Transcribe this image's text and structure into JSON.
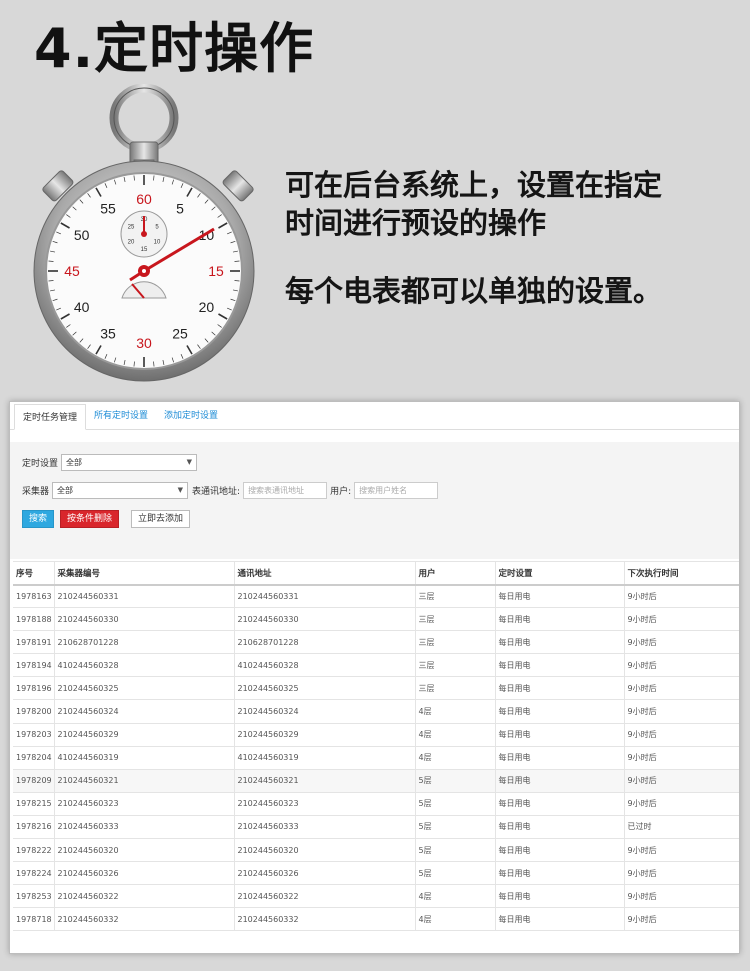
{
  "hero": {
    "title": "4.定时操作",
    "desc_line1": "可在后台系统上，设置在指定",
    "desc_line2": "时间进行预设的操作",
    "desc3": "每个电表都可以单独的设置。"
  },
  "stopwatch": {
    "numbers": [
      "60",
      "5",
      "10",
      "15",
      "20",
      "25",
      "30",
      "35",
      "40",
      "45",
      "50",
      "55"
    ],
    "sub_numbers": [
      "30",
      "5",
      "10",
      "15",
      "20",
      "25"
    ],
    "accent": "#c8161d"
  },
  "tabs": [
    {
      "label": "定时任务管理",
      "active": true
    },
    {
      "label": "所有定时设置",
      "active": false
    },
    {
      "label": "添加定时设置",
      "active": false
    }
  ],
  "filters": {
    "timer_label": "定时设置",
    "timer_value": "全部",
    "collector_label": "采集器",
    "collector_value": "全部",
    "address_label": "表通讯地址:",
    "address_placeholder": "搜索表通讯地址",
    "user_label": "用户:",
    "user_placeholder": "搜索用户姓名"
  },
  "buttons": {
    "search": "搜索",
    "delete": "按条件删除",
    "add": "立即去添加"
  },
  "table": {
    "headers": [
      "序号",
      "采集器编号",
      "通讯地址",
      "用户",
      "定时设置",
      "下次执行时间"
    ],
    "rows": [
      [
        "1978163",
        "210244560331",
        "210244560331",
        "三层",
        "每日用电",
        "9小时后"
      ],
      [
        "1978188",
        "210244560330",
        "210244560330",
        "三层",
        "每日用电",
        "9小时后"
      ],
      [
        "1978191",
        "210628701228",
        "210628701228",
        "三层",
        "每日用电",
        "9小时后"
      ],
      [
        "1978194",
        "410244560328",
        "410244560328",
        "三层",
        "每日用电",
        "9小时后"
      ],
      [
        "1978196",
        "210244560325",
        "210244560325",
        "三层",
        "每日用电",
        "9小时后"
      ],
      [
        "1978200",
        "210244560324",
        "210244560324",
        "4层",
        "每日用电",
        "9小时后"
      ],
      [
        "1978203",
        "210244560329",
        "210244560329",
        "4层",
        "每日用电",
        "9小时后"
      ],
      [
        "1978204",
        "410244560319",
        "410244560319",
        "4层",
        "每日用电",
        "9小时后"
      ],
      [
        "1978209",
        "210244560321",
        "210244560321",
        "5层",
        "每日用电",
        "9小时后"
      ],
      [
        "1978215",
        "210244560323",
        "210244560323",
        "5层",
        "每日用电",
        "9小时后"
      ],
      [
        "1978216",
        "210244560333",
        "210244560333",
        "5层",
        "每日用电",
        "已过时"
      ],
      [
        "1978222",
        "210244560320",
        "210244560320",
        "5层",
        "每日用电",
        "9小时后"
      ],
      [
        "1978224",
        "210244560326",
        "210244560326",
        "5层",
        "每日用电",
        "9小时后"
      ],
      [
        "1978253",
        "210244560322",
        "210244560322",
        "4层",
        "每日用电",
        "9小时后"
      ],
      [
        "1978718",
        "210244560332",
        "210244560332",
        "4层",
        "每日用电",
        "9小时后"
      ]
    ]
  }
}
